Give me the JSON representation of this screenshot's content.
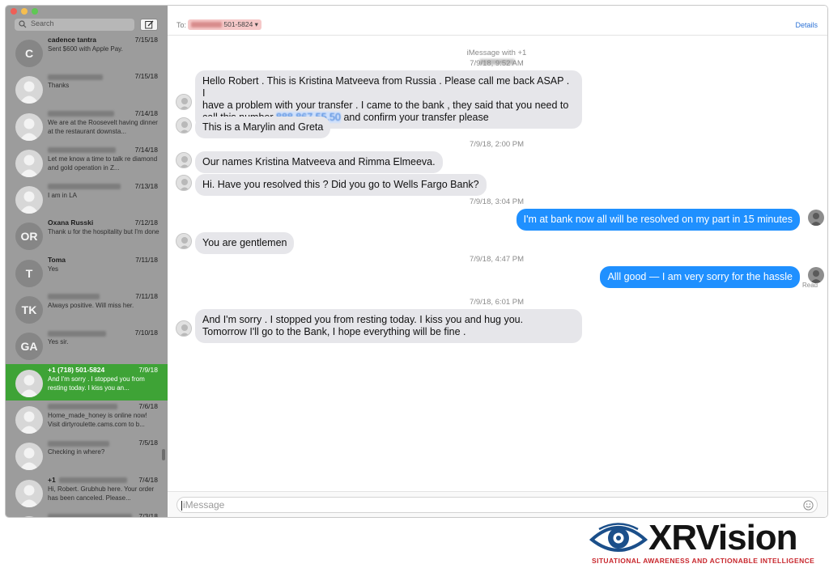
{
  "window": {
    "traffic_lights": [
      "close",
      "minimize",
      "maximize"
    ]
  },
  "sidebar": {
    "search_placeholder": "Search",
    "compose_icon": "compose-icon",
    "conversations": [
      {
        "name": "cadence tantra",
        "initials": "C",
        "date": "7/15/18",
        "preview": "Sent $600 with Apple Pay."
      },
      {
        "name": "",
        "initials": "",
        "date": "7/15/18",
        "preview": "Thanks"
      },
      {
        "name": "",
        "initials": "",
        "date": "7/14/18",
        "preview": "We are at the Roosevelt having dinner at the restaurant downsta..."
      },
      {
        "name": "",
        "initials": "",
        "date": "7/14/18",
        "preview": "Let me know a time to talk re diamond and gold operation in Z..."
      },
      {
        "name": "",
        "initials": "",
        "date": "7/13/18",
        "preview": "I am in LA"
      },
      {
        "name": "Oxana Russki",
        "initials": "OR",
        "date": "7/12/18",
        "preview": "Thank u for the hospitality but I'm done"
      },
      {
        "name": "Toma",
        "initials": "T",
        "date": "7/11/18",
        "preview": "Yes"
      },
      {
        "name": "",
        "initials": "TK",
        "date": "7/11/18",
        "preview": "Always positive. Will miss her."
      },
      {
        "name": "",
        "initials": "GA",
        "date": "7/10/18",
        "preview": "Yes sir."
      },
      {
        "name": "+1 (718) 501-5824",
        "initials": "",
        "date": "7/9/18",
        "preview": "And I'm sorry . I stopped you from resting today. I kiss you an...",
        "selected": true
      },
      {
        "name": "",
        "initials": "",
        "date": "7/6/18",
        "preview": "Home_made_honey is online now! Visit dirtyroulette.cams.com to b..."
      },
      {
        "name": "",
        "initials": "",
        "date": "7/5/18",
        "preview": "Checking in where?"
      },
      {
        "name": "+1",
        "initials": "",
        "date": "7/4/18",
        "preview": "Hi, Robert. Grubhub here. Your order has been canceled. Please..."
      },
      {
        "name": "",
        "initials": "",
        "date": "7/3/18",
        "preview": ""
      }
    ]
  },
  "header": {
    "to_label": "To:",
    "recipient": "501-5824",
    "details_label": "Details"
  },
  "thread": {
    "header_line": "iMessage with +1",
    "timestamps": [
      "7/9/18, 9:52 AM",
      "7/9/18, 2:00 PM",
      "7/9/18, 3:04 PM",
      "7/9/18, 4:47 PM",
      "7/9/18, 6:01 PM"
    ],
    "messages": [
      {
        "dir": "in",
        "lines": [
          "Hello Robert . This is Kristina Matveeva from Russia . Please call me back ASAP . I",
          "have a problem with your transfer . I came to the bank , they said that you need to"
        ],
        "line3_pre": "call this number ",
        "line3_link": "888.867.55.50",
        "line3_post": " and confirm your transfer please"
      },
      {
        "dir": "in",
        "text": "This is a Marylin and Greta"
      },
      {
        "dir": "in",
        "text": "Our names Kristina Matveeva and Rimma Elmeeva."
      },
      {
        "dir": "in",
        "text": "Hi. Have you resolved this ? Did you go to Wells Fargo Bank?"
      },
      {
        "dir": "out",
        "text": "I'm at bank now all will be resolved on my part in 15 minutes"
      },
      {
        "dir": "in",
        "text": "You are gentlemen"
      },
      {
        "dir": "out",
        "text": "Alll good — I am very sorry for the hassle"
      },
      {
        "dir": "in",
        "lines": [
          "And I'm sorry . I stopped you from resting today. I kiss you and hug you.",
          "Tomorrow I'll go to the Bank, I hope everything will be fine ."
        ]
      }
    ],
    "read_receipt": "Read"
  },
  "composer": {
    "placeholder": "iMessage",
    "emoji_icon": "emoji-icon"
  },
  "brand": {
    "name": "XRVision",
    "tagline": "SITUATIONAL AWARENESS AND ACTIONABLE INTELLIGENCE",
    "accent": "#c8262c",
    "eye_color": "#1b4f8a"
  },
  "colors": {
    "selected": "#3ea336",
    "outgoing": "#1f90ff",
    "incoming": "#e6e6ea",
    "sidebar": "#9c9c9c"
  }
}
